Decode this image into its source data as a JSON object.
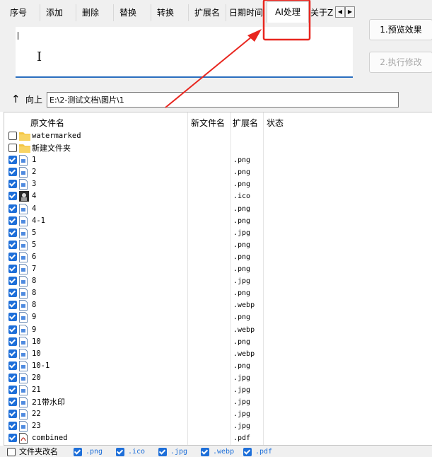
{
  "tabs": [
    {
      "label": "序号",
      "active": false
    },
    {
      "label": "添加",
      "active": false
    },
    {
      "label": "删除",
      "active": false
    },
    {
      "label": "替换",
      "active": false
    },
    {
      "label": "转换",
      "active": false
    },
    {
      "label": "扩展名",
      "active": false
    },
    {
      "label": "日期时间",
      "active": false
    },
    {
      "label": "AI处理",
      "active": true
    },
    {
      "label": "关于Z",
      "active": false
    }
  ],
  "editor": {
    "text": ""
  },
  "buttons": {
    "preview": "1.预览效果",
    "execute": "2.执行修改"
  },
  "pathbar": {
    "up_label": "向上",
    "path": "E:\\2-测试文档\\图片\\1"
  },
  "table": {
    "columns": [
      "原文件名",
      "新文件名",
      "扩展名",
      "状态"
    ],
    "rows": [
      {
        "name": "watermarked",
        "ext": "",
        "checked": false,
        "icon": "folder-icon"
      },
      {
        "name": "新建文件夹",
        "ext": "",
        "checked": false,
        "icon": "folder-icon"
      },
      {
        "name": "1",
        "ext": ".png",
        "checked": true,
        "icon": "file-icon"
      },
      {
        "name": "2",
        "ext": ".png",
        "checked": true,
        "icon": "file-icon"
      },
      {
        "name": "3",
        "ext": ".png",
        "checked": true,
        "icon": "file-icon"
      },
      {
        "name": "4",
        "ext": ".ico",
        "checked": true,
        "icon": "ico-thumbnail-icon"
      },
      {
        "name": "4",
        "ext": ".png",
        "checked": true,
        "icon": "file-icon"
      },
      {
        "name": "4-1",
        "ext": ".png",
        "checked": true,
        "icon": "file-icon"
      },
      {
        "name": "5",
        "ext": ".jpg",
        "checked": true,
        "icon": "file-icon"
      },
      {
        "name": "5",
        "ext": ".png",
        "checked": true,
        "icon": "file-icon"
      },
      {
        "name": "6",
        "ext": ".png",
        "checked": true,
        "icon": "file-icon"
      },
      {
        "name": "7",
        "ext": ".png",
        "checked": true,
        "icon": "file-icon"
      },
      {
        "name": "8",
        "ext": ".jpg",
        "checked": true,
        "icon": "file-icon"
      },
      {
        "name": "8",
        "ext": ".png",
        "checked": true,
        "icon": "file-icon"
      },
      {
        "name": "8",
        "ext": ".webp",
        "checked": true,
        "icon": "file-icon"
      },
      {
        "name": "9",
        "ext": ".png",
        "checked": true,
        "icon": "file-icon"
      },
      {
        "name": "9",
        "ext": ".webp",
        "checked": true,
        "icon": "file-icon"
      },
      {
        "name": "10",
        "ext": ".png",
        "checked": true,
        "icon": "file-icon"
      },
      {
        "name": "10",
        "ext": ".webp",
        "checked": true,
        "icon": "file-icon"
      },
      {
        "name": "10-1",
        "ext": ".png",
        "checked": true,
        "icon": "file-icon"
      },
      {
        "name": "20",
        "ext": ".jpg",
        "checked": true,
        "icon": "file-icon"
      },
      {
        "name": "21",
        "ext": ".jpg",
        "checked": true,
        "icon": "file-icon"
      },
      {
        "name": "21带水印",
        "ext": ".jpg",
        "checked": true,
        "icon": "file-icon"
      },
      {
        "name": "22",
        "ext": ".jpg",
        "checked": true,
        "icon": "file-icon"
      },
      {
        "name": "23",
        "ext": ".jpg",
        "checked": true,
        "icon": "file-icon"
      },
      {
        "name": "combined",
        "ext": ".pdf",
        "checked": true,
        "icon": "pdf-icon"
      }
    ]
  },
  "bottom": {
    "folder_rename": {
      "label": "文件夹改名",
      "checked": false
    },
    "filters": [
      {
        "label": ".png",
        "checked": true
      },
      {
        "label": ".ico",
        "checked": true
      },
      {
        "label": ".jpg",
        "checked": true
      },
      {
        "label": ".webp",
        "checked": true
      },
      {
        "label": ".pdf",
        "checked": true
      }
    ]
  },
  "colors": {
    "accent": "#1e6fd9",
    "annotation": "#e8261f",
    "folder": "#f4c542"
  }
}
